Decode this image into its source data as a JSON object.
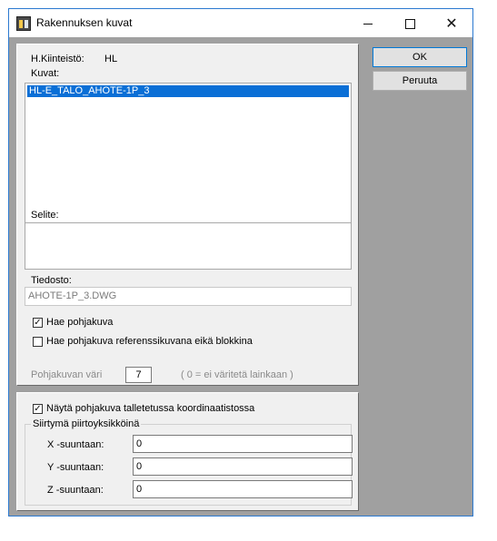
{
  "window": {
    "title": "Rakennuksen kuvat"
  },
  "titlebar": {
    "minimize": "—",
    "maximize": "☐",
    "close": "✕"
  },
  "property": {
    "label": "H.Kiinteistö:",
    "value": "HL"
  },
  "images": {
    "label": "Kuvat:",
    "items": [
      "HL-E_TALO_AHOTE-1P_3"
    ]
  },
  "description": {
    "label": "Selite:",
    "value": ""
  },
  "file": {
    "label": "Tiedosto:",
    "value": "AHOTE-1P_3.DWG"
  },
  "options": {
    "fetch_floorplan": {
      "label": "Hae pohjakuva",
      "checked": true
    },
    "fetch_as_reference": {
      "label": "Hae pohjakuva referenssikuvana eikä blokkina",
      "checked": false
    }
  },
  "color": {
    "label": "Pohjakuvan väri",
    "value": "7",
    "hint": "( 0 = ei väritetä lainkaan )"
  },
  "coordinates": {
    "show_in_saved": {
      "label": "Näytä pohjakuva talletetussa koordinaatistossa",
      "checked": true
    },
    "group_label": "Siirtymä piirtoyksikköinä",
    "x": {
      "label": "X -suuntaan:",
      "value": "0"
    },
    "y": {
      "label": "Y -suuntaan:",
      "value": "0"
    },
    "z": {
      "label": "Z -suuntaan:",
      "value": "0"
    }
  },
  "buttons": {
    "ok": "OK",
    "cancel": "Peruuta"
  }
}
